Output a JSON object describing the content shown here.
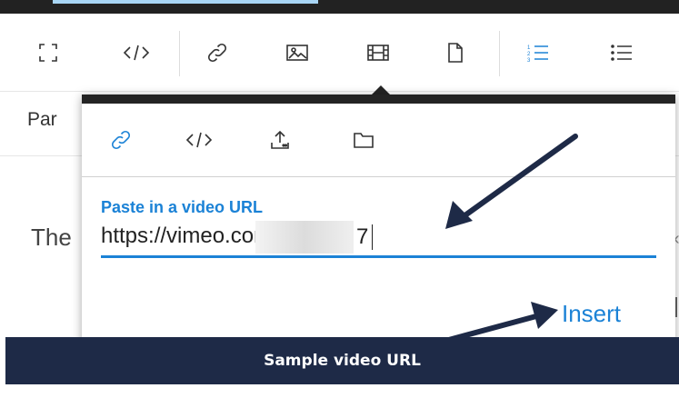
{
  "toolbar": {
    "icons": [
      "fullscreen-icon",
      "code-icon",
      "link-icon",
      "image-icon",
      "video-icon",
      "file-icon",
      "ordered-list-icon",
      "unordered-list-icon"
    ]
  },
  "editor": {
    "paragraph_partial": "Par",
    "body_partial": "The"
  },
  "video_popover": {
    "tabs": [
      "link-icon",
      "embed-code-icon",
      "upload-icon",
      "folder-icon"
    ],
    "field_label": "Paste in a video URL",
    "url_value": "https://vimeo.com/34",
    "url_tail": "7",
    "insert_label": "Insert"
  },
  "caption": "Sample video URL",
  "colors": {
    "accent": "#1b82d6",
    "toolbar_dark": "#242424",
    "caption_bg": "#1e2a47"
  }
}
